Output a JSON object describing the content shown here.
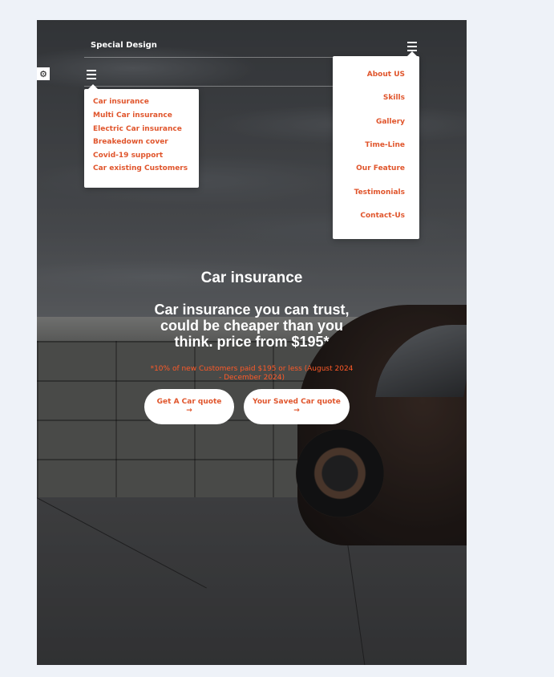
{
  "brand": "Special Design",
  "icons": {
    "menu": "hamburger-icon",
    "settings": "gear-icon",
    "arrow": "arrow-right-icon"
  },
  "colors": {
    "accent": "#e0552c",
    "note": "#ff5a28",
    "page_bg": "#eef2f8"
  },
  "left_menu": {
    "items": [
      "Car insurance",
      "Multi Car insurance",
      "Electric Car insurance",
      "Breakedown cover",
      "Covid-19 support",
      "Car existing Customers"
    ]
  },
  "right_menu": {
    "items": [
      "About US",
      "Skills",
      "Gallery",
      "Time-Line",
      "Our Feature",
      "Testimonials",
      "Contact-Us"
    ]
  },
  "hero": {
    "title": "Car insurance",
    "subtitle": "Car insurance you can trust, could be cheaper than you think. price from $195*",
    "note": "*10% of new Customers paid $195 or less (August 2024 - December 2024)",
    "buttons": [
      {
        "label": "Get A Car quote",
        "arrow": "→"
      },
      {
        "label": "Your Saved Car quote",
        "arrow": "→"
      }
    ]
  }
}
